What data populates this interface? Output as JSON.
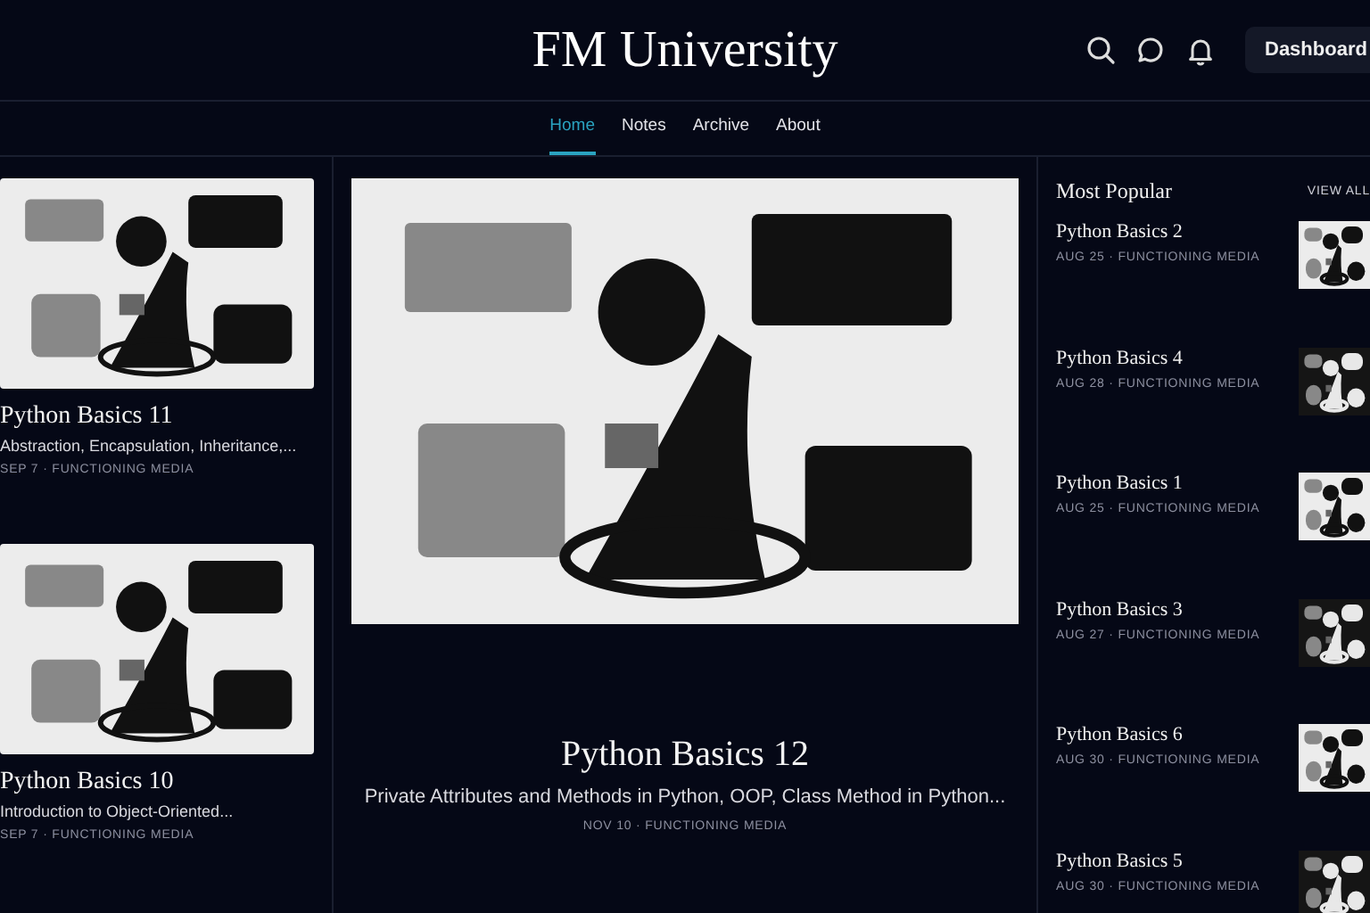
{
  "header": {
    "title": "FM University",
    "button": "Dashboard"
  },
  "nav": [
    {
      "label": "Home",
      "selected": true
    },
    {
      "label": "Notes",
      "selected": false
    },
    {
      "label": "Archive",
      "selected": false
    },
    {
      "label": "About",
      "selected": false
    }
  ],
  "side_posts": [
    {
      "title": "Python Basics 11",
      "excerpt": "Abstraction, Encapsulation, Inheritance,...",
      "meta": "SEP 7 · FUNCTIONING MEDIA"
    },
    {
      "title": "Python Basics 10",
      "excerpt": "Introduction to Object-Oriented...",
      "meta": "SEP 7 · FUNCTIONING MEDIA"
    }
  ],
  "featured": {
    "title": "Python Basics 12",
    "excerpt": "Private Attributes and Methods in Python, OOP, Class Method in Python...",
    "meta": "NOV 10 · FUNCTIONING MEDIA"
  },
  "most_popular": {
    "heading": "Most Popular",
    "link": "VIEW ALL",
    "items": [
      {
        "title": "Python Basics 2",
        "meta": "AUG 25 · FUNCTIONING MEDIA"
      },
      {
        "title": "Python Basics 4",
        "meta": "AUG 28 · FUNCTIONING MEDIA"
      },
      {
        "title": "Python Basics 1",
        "meta": "AUG 25 · FUNCTIONING MEDIA"
      },
      {
        "title": "Python Basics 3",
        "meta": "AUG 27 · FUNCTIONING MEDIA"
      },
      {
        "title": "Python Basics 6",
        "meta": "AUG 30 · FUNCTIONING MEDIA"
      },
      {
        "title": "Python Basics 5",
        "meta": "AUG 30 · FUNCTIONING MEDIA"
      }
    ]
  }
}
